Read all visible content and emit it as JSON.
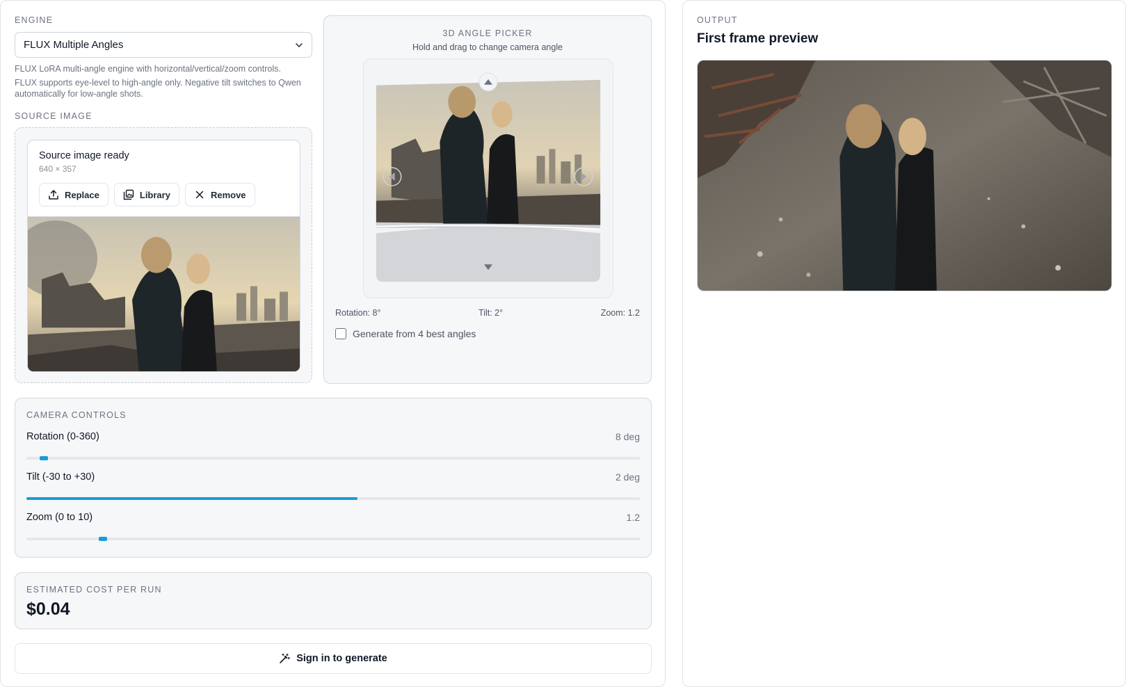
{
  "engine": {
    "label": "ENGINE",
    "selected": "FLUX Multiple Angles",
    "hint1": "FLUX LoRA multi-angle engine with horizontal/vertical/zoom controls.",
    "hint2": "FLUX supports eye-level to high-angle only. Negative tilt switches to Qwen automatically for low-angle shots."
  },
  "source": {
    "label": "SOURCE IMAGE",
    "status": "Source image ready",
    "dimensions": "640 × 357",
    "buttons": {
      "replace": "Replace",
      "library": "Library",
      "remove": "Remove"
    }
  },
  "picker": {
    "title": "3D ANGLE PICKER",
    "subtitle": "Hold and drag to change camera angle",
    "rotation_readout": "Rotation: 8°",
    "tilt_readout": "Tilt: 2°",
    "zoom_readout": "Zoom: 1.2",
    "best_angles_label": "Generate from 4 best angles",
    "best_angles_checked": false
  },
  "controls": {
    "label": "CAMERA CONTROLS",
    "rotation": {
      "name": "Rotation (0-360)",
      "value_text": "8 deg",
      "fraction": 0.028
    },
    "tilt": {
      "name": "Tilt (-30 to +30)",
      "value_text": "2 deg",
      "fraction": 0.54
    },
    "zoom": {
      "name": "Zoom (0 to 10)",
      "value_text": "1.2",
      "fraction": 0.125
    }
  },
  "cost": {
    "label": "ESTIMATED COST PER RUN",
    "value": "$0.04"
  },
  "signin": {
    "label": "Sign in to generate"
  },
  "output": {
    "label": "OUTPUT",
    "title": "First frame preview"
  },
  "colors": {
    "accent": "#1b9ad8",
    "panel_bg": "#f6f7f9",
    "border": "#d4d8de"
  },
  "icons": [
    "chevron-down-icon",
    "upload-icon",
    "library-icon",
    "close-icon",
    "arrow-up-icon",
    "arrow-down-icon",
    "arrow-left-icon",
    "arrow-right-icon",
    "magic-wand-icon"
  ]
}
